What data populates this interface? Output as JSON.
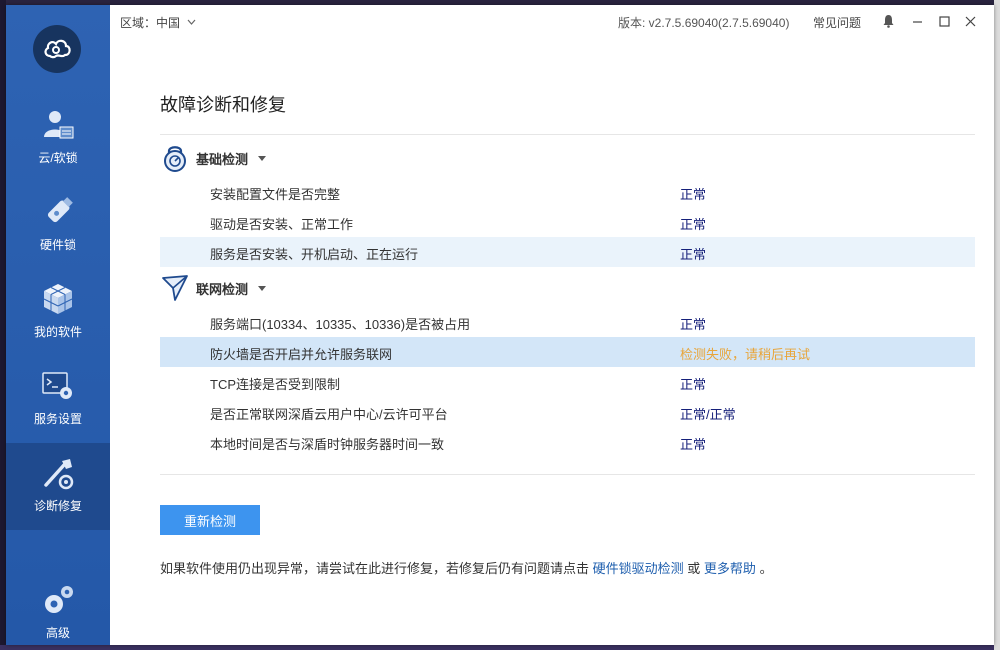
{
  "topbar": {
    "region_label": "区域：",
    "region_value": "中国",
    "version": "版本: v2.7.5.69040(2.7.5.69040)",
    "faq": "常见问题"
  },
  "sidebar": {
    "items": [
      {
        "label": "云/软锁",
        "icon": "user-card-icon"
      },
      {
        "label": "硬件锁",
        "icon": "usb-dongle-icon"
      },
      {
        "label": "我的软件",
        "icon": "cubes-icon"
      },
      {
        "label": "服务设置",
        "icon": "terminal-gear-icon"
      },
      {
        "label": "诊断修复",
        "icon": "wrench-gear-icon"
      },
      {
        "label": "高级",
        "icon": "gears-icon"
      }
    ],
    "active_index": 4
  },
  "main": {
    "title": "故障诊断和修复",
    "sections": [
      {
        "title": "基础检测",
        "rows": [
          {
            "label": "安装配置文件是否完整",
            "status": "正常"
          },
          {
            "label": "驱动是否安装、正常工作",
            "status": "正常"
          },
          {
            "label": "服务是否安装、开机启动、正在运行",
            "status": "正常"
          }
        ]
      },
      {
        "title": "联网检测",
        "rows": [
          {
            "label": "服务端口(10334、10335、10336)是否被占用",
            "status": "正常"
          },
          {
            "label": "防火墙是否开启并允许服务联网",
            "status": "检测失败，请稍后再试"
          },
          {
            "label": "TCP连接是否受到限制",
            "status": "正常"
          },
          {
            "label": "是否正常联网深盾云用户中心/云许可平台",
            "status": "正常/正常"
          },
          {
            "label": "本地时间是否与深盾时钟服务器时间一致",
            "status": "正常"
          }
        ]
      }
    ],
    "recheck_button": "重新检测",
    "footer": {
      "prefix": "如果软件使用仍出现异常，请尝试在此进行修复，若修复后仍有问题请点击",
      "link1": "硬件锁驱动检测",
      "middle": "或",
      "link2": "更多帮助",
      "suffix": "。"
    }
  },
  "colors": {
    "sidebar": "#2e63b3",
    "status_ok": "#16207a",
    "status_warn": "#e8a53a",
    "button": "#3d94ef",
    "link": "#1f5fae"
  }
}
